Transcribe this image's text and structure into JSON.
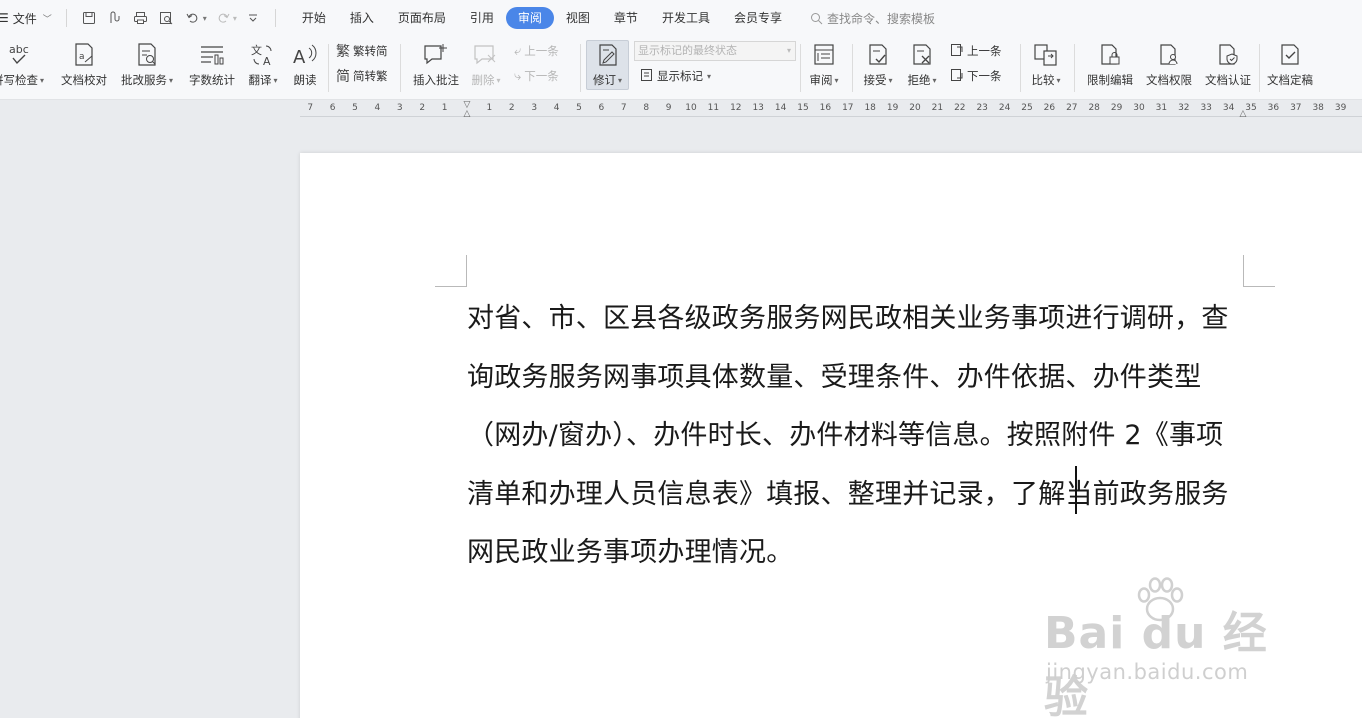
{
  "menu": {
    "file_label": "文件",
    "tabs": [
      "开始",
      "插入",
      "页面布局",
      "引用",
      "审阅",
      "视图",
      "章节",
      "开发工具",
      "会员专享"
    ],
    "active_tab": "审阅",
    "search_placeholder": "查找命令、搜索模板"
  },
  "ribbon": {
    "spell_check": "拼写检查",
    "doc_proofread": "文档校对",
    "correction_service": "批改服务",
    "word_count": "字数统计",
    "translate": "翻译",
    "read_aloud": "朗读",
    "trad_convert": "繁转简",
    "simp_convert": "简转繁",
    "insert_comment": "插入批注",
    "delete": "删除",
    "prev_comment": "上一条",
    "next_comment": "下一条",
    "track_changes": "修订",
    "markup_mode": "显示标记的最终状态",
    "show_markup": "显示标记",
    "review": "审阅",
    "accept": "接受",
    "reject": "拒绝",
    "prev_change": "上一条",
    "next_change": "下一条",
    "compare": "比较",
    "restrict_editing": "限制编辑",
    "doc_permissions": "文档权限",
    "doc_certification": "文档认证",
    "doc_finalize": "文档定稿"
  },
  "ruler": {
    "left_ticks": [
      "7",
      "6",
      "5",
      "4",
      "3",
      "2",
      "1"
    ],
    "right_ticks": [
      "1",
      "2",
      "3",
      "4",
      "5",
      "6",
      "7",
      "8",
      "9",
      "10",
      "11",
      "12",
      "13",
      "14",
      "15",
      "16",
      "17",
      "18",
      "19",
      "20",
      "21",
      "22",
      "23",
      "24",
      "25",
      "26",
      "27",
      "28",
      "29",
      "30",
      "31",
      "32",
      "33",
      "34",
      "35",
      "36",
      "37",
      "38",
      "39"
    ]
  },
  "document": {
    "paragraph": "对省、市、区县各级政务服务网民政相关业务事项进行调研，查询政务服务网事项具体数量、受理条件、办件依据、办件类型（网办/窗办）、办件时长、办件材料等信息。按照附件 2《事项清单和办理人员信息表》填报、整理并记录，了解当前政务服务网民政业务事项办理情况。"
  },
  "watermark": {
    "brand": "Bai du 经验",
    "url": "jingyan.baidu.com"
  },
  "colors": {
    "active_tab_bg": "#4a86e8",
    "chrome_bg": "#f7f8fa",
    "canvas_bg": "#e9ebee"
  }
}
